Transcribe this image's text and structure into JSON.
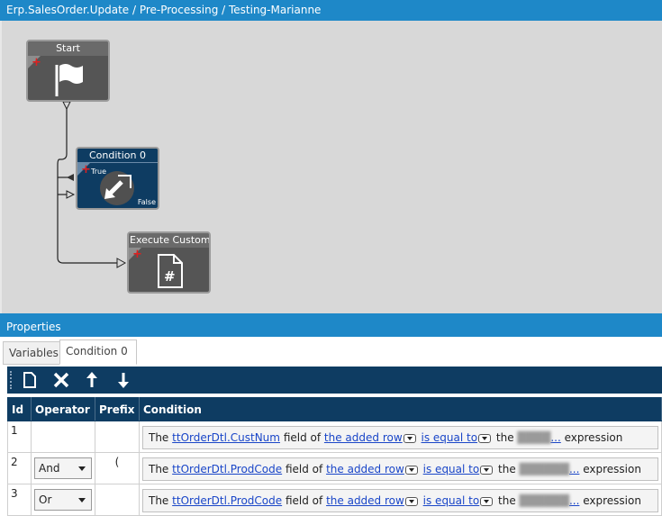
{
  "window": {
    "title": "Erp.SalesOrder.Update / Pre-Processing / Testing-Marianne"
  },
  "workflow": {
    "nodes": [
      {
        "title": "Start",
        "icon": "flag-icon"
      },
      {
        "title": "Condition 0",
        "true_label": "True",
        "false_label": "False",
        "icon": "exit-arrow-icon"
      },
      {
        "title": "Execute Custom Co",
        "icon": "csharp-file-icon"
      }
    ]
  },
  "properties": {
    "title": "Properties",
    "tabs": [
      {
        "label": "Variables"
      },
      {
        "label": "Condition 0"
      }
    ],
    "toolbar": [
      "new-icon",
      "delete-icon",
      "move-up-icon",
      "move-down-icon"
    ],
    "grid": {
      "columns": [
        "Id",
        "Operator",
        "Prefix",
        "Condition"
      ],
      "rows": [
        {
          "id": "1",
          "operator": "",
          "prefix": "",
          "cond_pre": "The",
          "field": "ttOrderDtl.CustNum",
          "cond_mid1": "field of",
          "row": "the added row",
          "op": "is equal to",
          "cond_mid2": "the",
          "expr": "...",
          "cond_post": "expression"
        },
        {
          "id": "2",
          "operator": "And",
          "prefix": "(",
          "cond_pre": "The",
          "field": "ttOrderDtl.ProdCode",
          "cond_mid1": "field of",
          "row": "the added row",
          "op": "is equal to",
          "cond_mid2": "the",
          "expr": "...",
          "cond_post": "expression"
        },
        {
          "id": "3",
          "operator": "Or",
          "prefix": "",
          "cond_pre": "The",
          "field": "ttOrderDtl.ProdCode",
          "cond_mid1": "field of",
          "row": "the added row",
          "op": "is equal to",
          "cond_mid2": "the",
          "expr": "...",
          "cond_post": "expression"
        }
      ]
    }
  }
}
